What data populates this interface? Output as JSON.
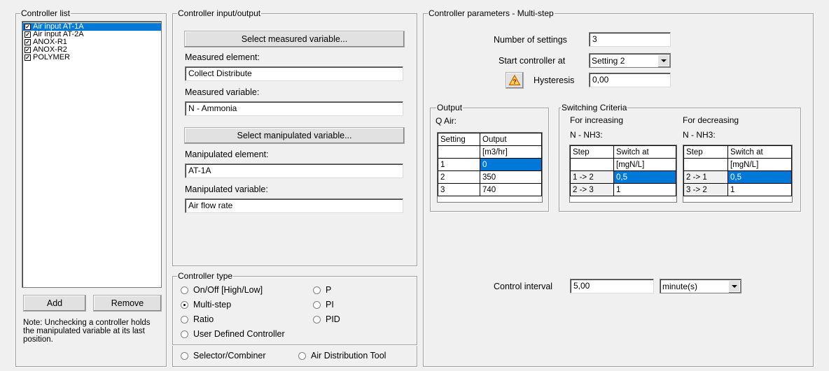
{
  "controller_list": {
    "title": "Controller list",
    "items": [
      {
        "label": "Air input AT-1A",
        "checked": true,
        "selected": true
      },
      {
        "label": "Air input AT-2A",
        "checked": true,
        "selected": false
      },
      {
        "label": "ANOX-R1",
        "checked": true,
        "selected": false
      },
      {
        "label": "ANOX-R2",
        "checked": true,
        "selected": false
      },
      {
        "label": "POLYMER",
        "checked": true,
        "selected": false
      }
    ],
    "add_label": "Add",
    "remove_label": "Remove",
    "note": "Note: Unchecking a controller holds the manipulated variable at its last position."
  },
  "io": {
    "title": "Controller input/output",
    "select_measured_label": "Select measured variable...",
    "measured_element_label": "Measured element:",
    "measured_element_value": "Collect Distribute",
    "measured_variable_label": "Measured variable:",
    "measured_variable_value": "N - Ammonia",
    "select_manipulated_label": "Select manipulated variable...",
    "manipulated_element_label": "Manipulated element:",
    "manipulated_element_value": "AT-1A",
    "manipulated_variable_label": "Manipulated variable:",
    "manipulated_variable_value": "Air flow rate"
  },
  "controller_type": {
    "title": "Controller type",
    "options": {
      "onoff": "On/Off [High/Low]",
      "multistep": "Multi-step",
      "ratio": "Ratio",
      "user": "User Defined Controller",
      "p": "P",
      "pi": "PI",
      "pid": "PID",
      "selector": "Selector/Combiner",
      "airdist": "Air Distribution Tool"
    },
    "selected": "multistep"
  },
  "params": {
    "title": "Controller parameters - Multi-step",
    "num_settings_label": "Number of settings",
    "num_settings_value": "3",
    "start_at_label": "Start controller at",
    "start_at_value": "Setting 2",
    "hysteresis_label": "Hysteresis",
    "hysteresis_value": "0,00",
    "output": {
      "title": "Output",
      "subtitle": "Q Air:",
      "headers": [
        "Setting",
        "Output"
      ],
      "units": [
        "",
        "[m3/hr]"
      ],
      "rows": [
        [
          "1",
          "0"
        ],
        [
          "2",
          "350"
        ],
        [
          "3",
          "740"
        ]
      ]
    },
    "switching": {
      "title": "Switching Criteria",
      "increasing_label": "For increasing",
      "decreasing_label": "For decreasing",
      "var_label_inc": "N - NH3:",
      "var_label_dec": "N - NH3:",
      "headers": [
        "Step",
        "Switch at"
      ],
      "units": [
        "",
        "[mgN/L]"
      ],
      "increasing_rows": [
        [
          "1 -> 2",
          "0,5"
        ],
        [
          "2 -> 3",
          "1"
        ]
      ],
      "decreasing_rows": [
        [
          "2 -> 1",
          "0,5"
        ],
        [
          "3 -> 2",
          "1"
        ]
      ]
    },
    "control_interval_label": "Control interval",
    "control_interval_value": "5,00",
    "control_interval_unit": "minute(s)"
  },
  "colors": {
    "selection": "#0078d7",
    "face": "#f0f0f0"
  }
}
